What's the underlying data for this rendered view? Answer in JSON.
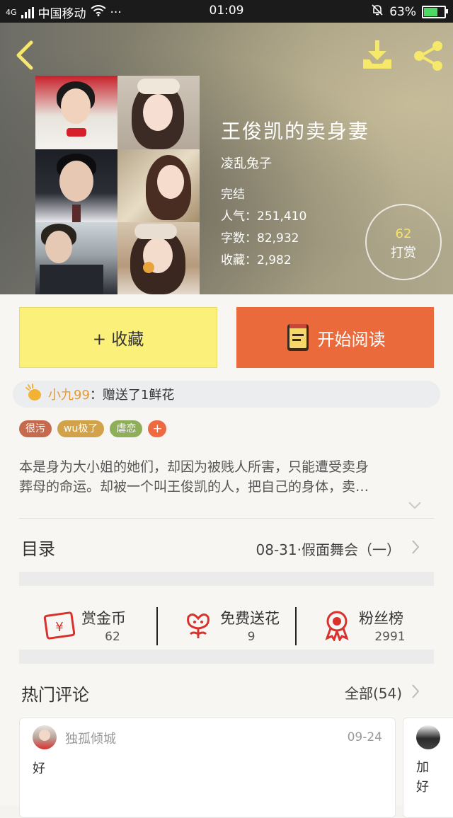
{
  "status_bar": {
    "network": "4G",
    "carrier": "中国移动",
    "time": "01:09",
    "battery": "63%",
    "battery_level": 0.63
  },
  "book": {
    "title": "王俊凯的卖身妻",
    "author": "凌乱兔子",
    "status": "完结",
    "popularity": "人气：251,410",
    "word_count": "字数：82,932",
    "favorites": "收藏：2,982",
    "tip_count": "62",
    "tip_label": "打赏"
  },
  "actions": {
    "favorite_label": "+ 收藏",
    "read_label": "开始阅读"
  },
  "gift_notice": {
    "user": "小九99",
    "text": "：赠送了1鲜花"
  },
  "tags": [
    {
      "label": "很污",
      "color": "#c66a4e"
    },
    {
      "label": "wu极了",
      "color": "#d2a24a"
    },
    {
      "label": "虐恋",
      "color": "#8fae59"
    }
  ],
  "tag_add_label": "+",
  "intro": {
    "line1": "本是身为大小姐的她们，却因为被贱人所害，只能遭受卖身",
    "line2": "葬母的命运。却被一个叫王俊凯的人，把自己的身体，卖…"
  },
  "toc": {
    "label": "目录",
    "latest": "08-31·假面舞会（一）"
  },
  "rewards": [
    {
      "label": "赏金币",
      "value": "62"
    },
    {
      "label": "免费送花",
      "value": "9"
    },
    {
      "label": "粉丝榜",
      "value": "2991"
    }
  ],
  "hot_comments": {
    "title": "热门评论",
    "all_label": "全部(54)",
    "items": [
      {
        "user": "独孤倾城",
        "date": "09-24",
        "text": "好"
      },
      {
        "line1": "加",
        "line2": "好"
      }
    ]
  },
  "colors": {
    "accent_orange": "#ea6a3b",
    "accent_yellow": "#fbf07a",
    "gift_user": "#e59a3a"
  }
}
